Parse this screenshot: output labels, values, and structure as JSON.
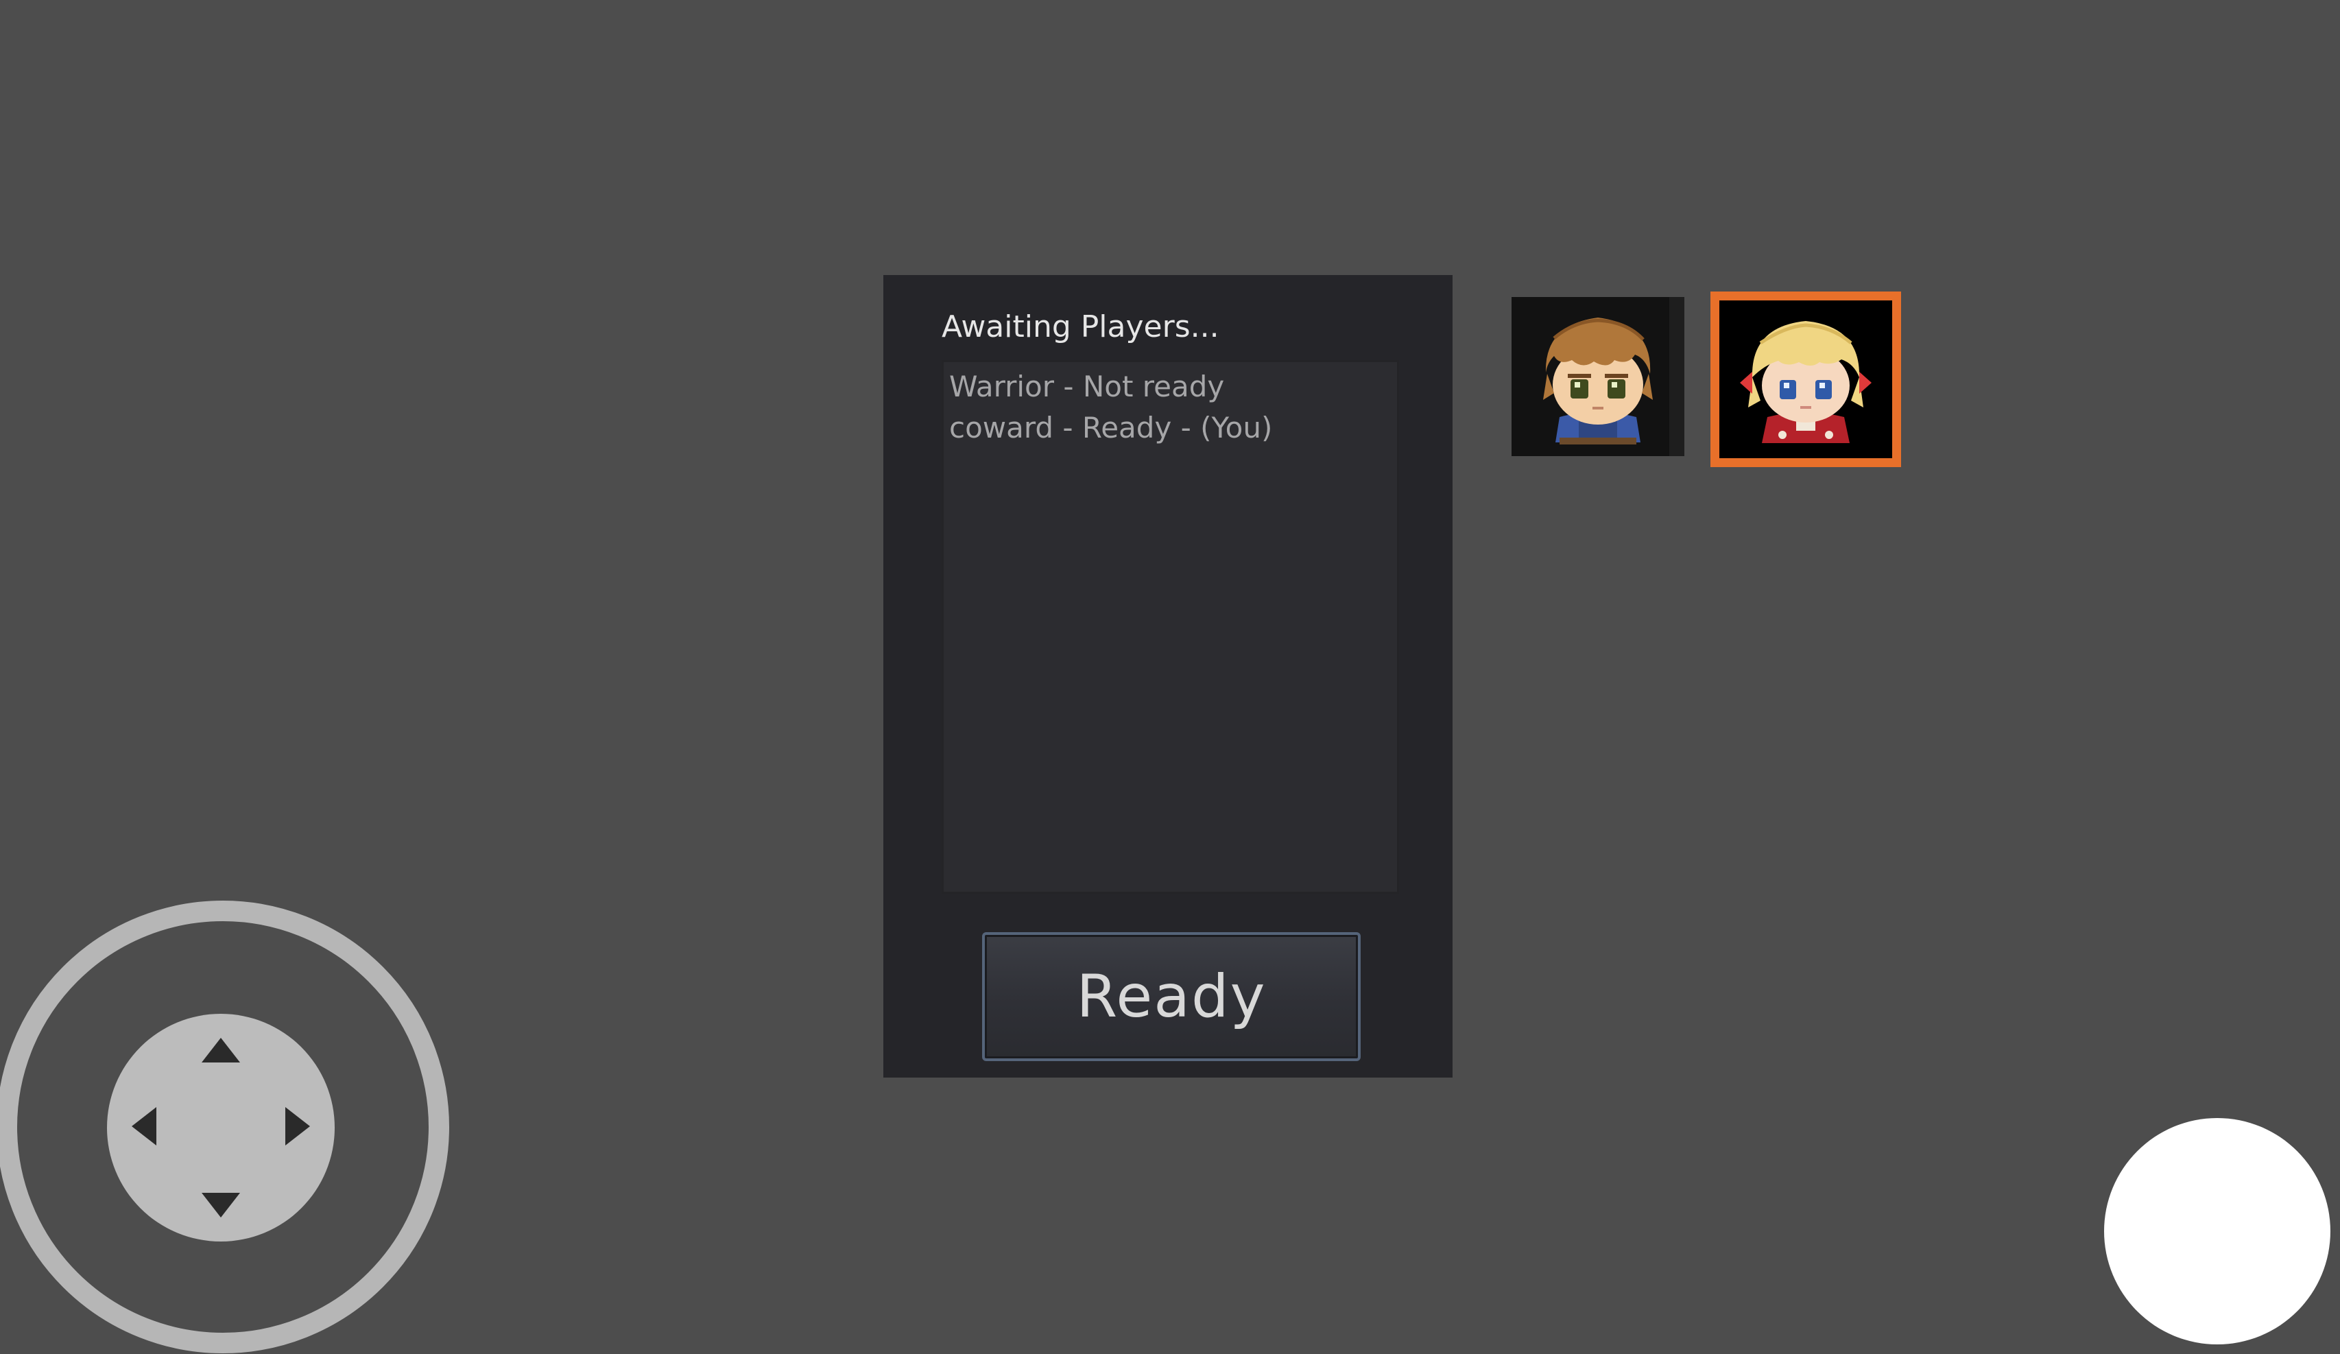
{
  "lobby": {
    "title": "Awaiting Players...",
    "players": [
      "Warrior - Not ready",
      "coward - Ready - (You)"
    ],
    "ready_button_label": "Ready"
  },
  "characters": [
    {
      "icon": "warrior-portrait-icon",
      "selected": false
    },
    {
      "icon": "blonde-girl-portrait-icon",
      "selected": true
    }
  ],
  "colors": {
    "background": "#4d4d4d",
    "panel": "#252529",
    "selection_border": "#e8702a"
  },
  "controls": {
    "joystick": "dpad-icon",
    "action": "action-button"
  }
}
